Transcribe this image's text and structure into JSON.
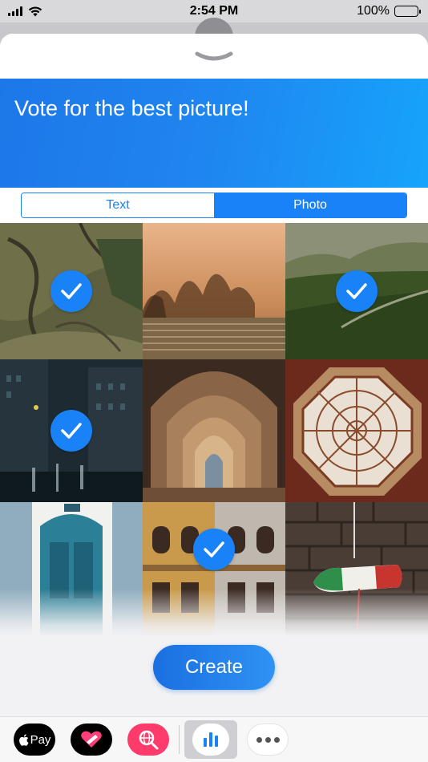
{
  "status_bar": {
    "time": "2:54 PM",
    "battery": "100%",
    "signal_icon": "cellular-signal-icon",
    "wifi_icon": "wifi-icon",
    "battery_icon": "battery-icon"
  },
  "sheet": {
    "collapse_icon": "chevron-down-icon",
    "banner_title": "Vote for the best picture!"
  },
  "segments": {
    "text_label": "Text",
    "photo_label": "Photo",
    "selected": "Photo"
  },
  "photos": [
    {
      "subject": "aerial-fields",
      "selected": true
    },
    {
      "subject": "misty-trees",
      "selected": false
    },
    {
      "subject": "green-valley",
      "selected": true
    },
    {
      "subject": "rainy-street",
      "selected": true
    },
    {
      "subject": "arched-corridor",
      "selected": false
    },
    {
      "subject": "octagonal-skylight",
      "selected": false
    },
    {
      "subject": "blue-door",
      "selected": false
    },
    {
      "subject": "building-facade",
      "selected": true
    },
    {
      "subject": "shoe-on-wall",
      "selected": false
    }
  ],
  "create_label": "Create",
  "app_drawer": {
    "apple_pay_label": "Pay",
    "apps": [
      "apple-pay-icon",
      "heart-sticker-icon",
      "search-globe-icon",
      "poll-icon",
      "more-icon"
    ]
  },
  "colors": {
    "accent": "#1a82f7",
    "banner_start": "#1d77e8",
    "banner_end": "#16a4fb"
  }
}
